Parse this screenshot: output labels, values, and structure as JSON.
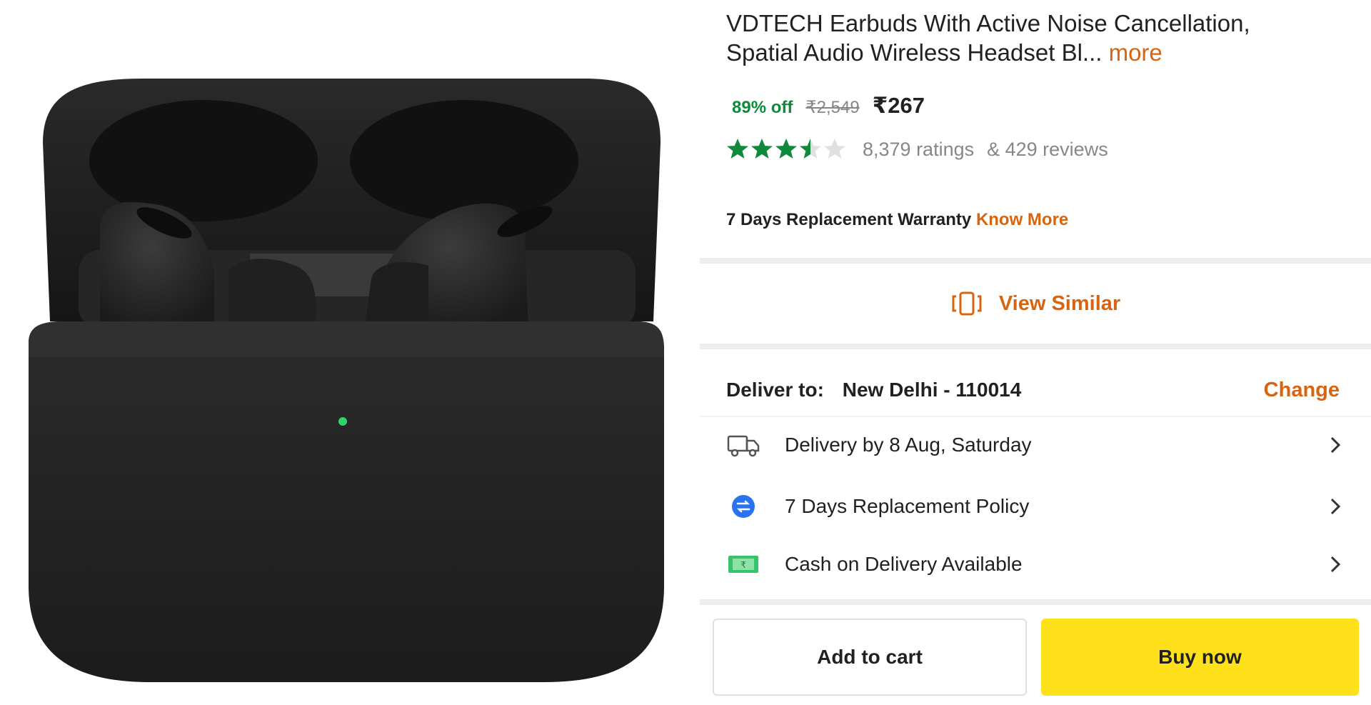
{
  "product": {
    "title": "VDTECH Earbuds With Active Noise Cancellation, Spatial Audio Wireless Headset Bl...",
    "more_label": "more",
    "image_icon": "black-earbuds-case-image"
  },
  "pricing": {
    "discount": "89% off",
    "mrp": "₹2,549",
    "price": "₹267"
  },
  "rating": {
    "stars": 3.5,
    "max_stars": 5,
    "ratings_count": "8,379 ratings",
    "reviews_count": "& 429 reviews",
    "star_color": "#0f8a3c"
  },
  "warranty": {
    "text": "7 Days Replacement Warranty",
    "link": "Know More"
  },
  "view_similar": {
    "label": "View Similar",
    "icon": "view-similar-icon"
  },
  "delivery": {
    "label": "Deliver to:",
    "location": "New Delhi - 110014",
    "change_label": "Change",
    "rows": [
      {
        "icon": "truck-icon",
        "text": "Delivery by 8 Aug, Saturday"
      },
      {
        "icon": "replacement-icon",
        "text": "7 Days Replacement Policy"
      },
      {
        "icon": "cash-icon",
        "text": "Cash on Delivery Available"
      }
    ]
  },
  "actions": {
    "add_to_cart": "Add to cart",
    "buy_now": "Buy now",
    "buy_now_color": "#ffe11b"
  },
  "colors": {
    "accent": "#d9640f",
    "discount_green": "#0f8a3c"
  }
}
